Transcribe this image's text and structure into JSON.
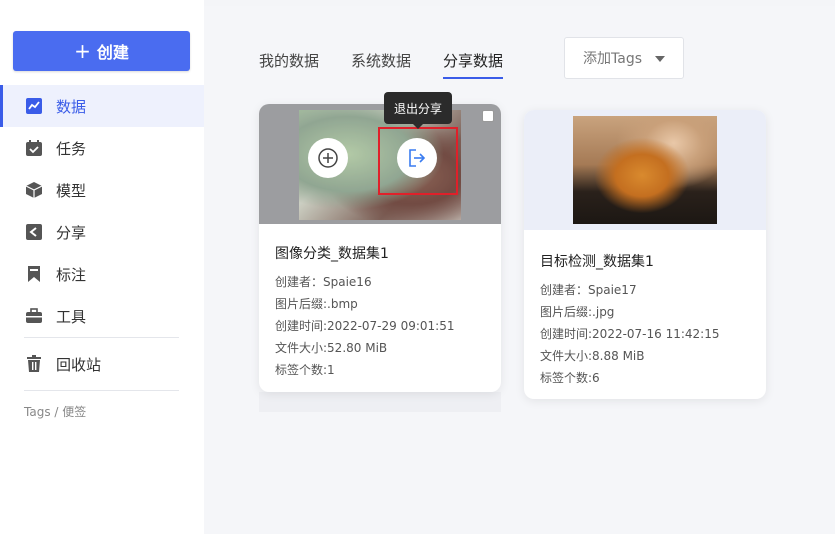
{
  "sidebar": {
    "create_label": "创建",
    "items": [
      {
        "label": "数据",
        "icon": "chart-icon",
        "active": true
      },
      {
        "label": "任务",
        "icon": "calendar-check-icon"
      },
      {
        "label": "模型",
        "icon": "cube-icon"
      },
      {
        "label": "分享",
        "icon": "share-icon"
      },
      {
        "label": "标注",
        "icon": "bookmark-icon"
      },
      {
        "label": "工具",
        "icon": "toolbox-icon"
      },
      {
        "label": "回收站",
        "icon": "trash-icon"
      }
    ],
    "tags_label": "Tags / 便签"
  },
  "tabs": [
    {
      "label": "我的数据"
    },
    {
      "label": "系统数据"
    },
    {
      "label": "分享数据",
      "active": true
    }
  ],
  "tags_select": {
    "placeholder": "添加Tags"
  },
  "tooltip": "退出分享",
  "cards": [
    {
      "title": "图像分类_数据集1",
      "creator": "创建者：Spaie16",
      "suffix": "图片后缀:.bmp",
      "created": "创建时间:2022-07-29 09:01:51",
      "size": "文件大小:52.80 MiB",
      "tags": "标签个数:1"
    },
    {
      "title": "目标检测_数据集1",
      "creator": "创建者：Spaie17",
      "suffix": "图片后缀:.jpg",
      "created": "创建时间:2022-07-16 11:42:15",
      "size": "文件大小:8.88 MiB",
      "tags": "标签个数:6"
    }
  ],
  "colors": {
    "accent": "#4a6cf0",
    "highlight": "#e0202a"
  }
}
